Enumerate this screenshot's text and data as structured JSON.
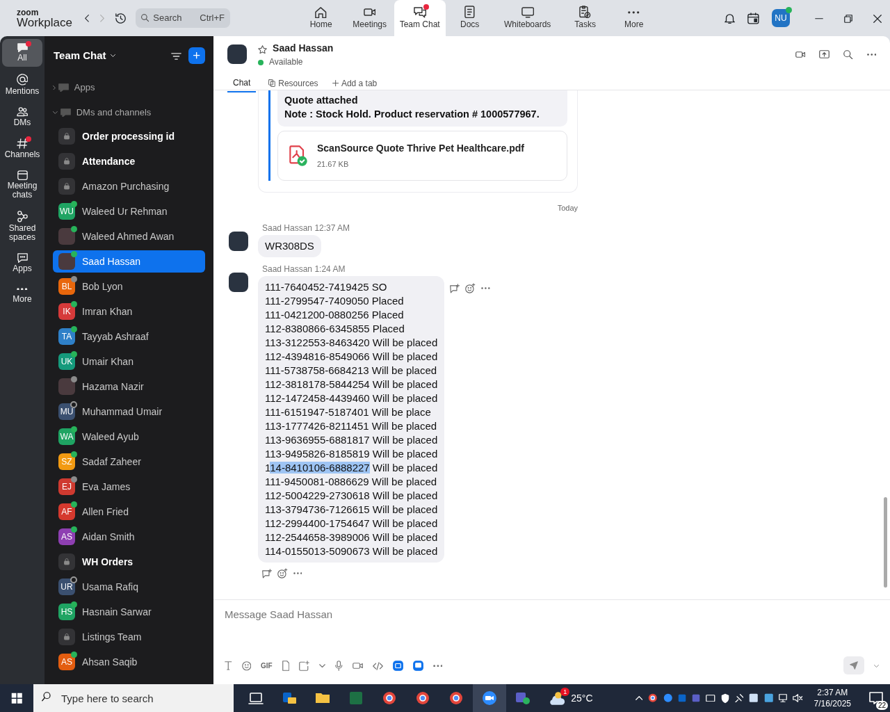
{
  "app": {
    "logo_top": "zoom",
    "logo": "Workplace",
    "search": {
      "placeholder": "Search",
      "shortcut": "Ctrl+F"
    },
    "nav_tabs": [
      {
        "label": "Home",
        "selected": false,
        "badge": false
      },
      {
        "label": "Meetings",
        "selected": false,
        "badge": false
      },
      {
        "label": "Team Chat",
        "selected": true,
        "badge": true
      },
      {
        "label": "Docs",
        "selected": false,
        "badge": false
      },
      {
        "label": "Whiteboards",
        "selected": false,
        "badge": false
      },
      {
        "label": "Tasks",
        "selected": false,
        "badge": false
      },
      {
        "label": "More",
        "selected": false,
        "badge": false
      }
    ],
    "profile": {
      "initials": "NU",
      "presence_dot": {
        "color": "#27b35a",
        "hollow": false
      }
    }
  },
  "rail": [
    {
      "label": "All",
      "selected": true,
      "badge": true
    },
    {
      "label": "Mentions",
      "selected": false,
      "badge": false
    },
    {
      "label": "DMs",
      "selected": false,
      "badge": false
    },
    {
      "label": "Channels",
      "selected": false,
      "badge": true
    },
    {
      "label": "Meeting chats",
      "selected": false,
      "badge": false
    },
    {
      "label": "Shared spaces",
      "selected": false,
      "badge": false
    },
    {
      "label": "Apps",
      "selected": false,
      "badge": false
    },
    {
      "label": "More",
      "selected": false,
      "badge": false
    }
  ],
  "sidebar": {
    "title": "Team Chat",
    "sections": [
      {
        "label": "Apps",
        "expanded": false
      },
      {
        "label": "DMs and channels",
        "expanded": true
      }
    ],
    "chats": [
      {
        "kind": "channel",
        "name": "Order processing id",
        "unread": true,
        "selected": false
      },
      {
        "kind": "channel",
        "name": "Attendance",
        "unread": true,
        "selected": false
      },
      {
        "kind": "channel",
        "name": "Amazon Purchasing",
        "unread": false,
        "selected": false
      },
      {
        "kind": "initials",
        "initials": "WU",
        "color": "#1fa463",
        "name": "Waleed Ur Rehman",
        "unread": false,
        "selected": false,
        "presence_dot": {
          "color": "#27b35a",
          "hollow": false
        }
      },
      {
        "kind": "photo",
        "name": "Waleed Ahmed Awan",
        "unread": false,
        "selected": false,
        "presence_dot": {
          "color": "#27b35a",
          "hollow": false
        }
      },
      {
        "kind": "photo",
        "name": "Saad Hassan",
        "unread": false,
        "selected": true,
        "presence_dot": {
          "color": "#27b35a",
          "hollow": false
        }
      },
      {
        "kind": "initials",
        "initials": "BL",
        "color": "#e8670c",
        "name": "Bob Lyon",
        "unread": false,
        "selected": false,
        "presence_dot": {
          "color": "#8b8b8b",
          "hollow": false
        }
      },
      {
        "kind": "initials",
        "initials": "IK",
        "color": "#d63a3a",
        "name": "Imran Khan",
        "unread": false,
        "selected": false,
        "presence_dot": {
          "color": "#27b35a",
          "hollow": false
        }
      },
      {
        "kind": "initials",
        "initials": "TA",
        "color": "#2f80c8",
        "name": "Tayyab Ashraaf",
        "unread": false,
        "selected": false,
        "presence_dot": {
          "color": "#27b35a",
          "hollow": false
        }
      },
      {
        "kind": "initials",
        "initials": "UK",
        "color": "#159a7c",
        "name": "Umair Khan",
        "unread": false,
        "selected": false,
        "presence_dot": {
          "color": "#27b35a",
          "hollow": false
        }
      },
      {
        "kind": "photo",
        "name": "Hazama Nazir",
        "unread": false,
        "selected": false,
        "presence_dot": {
          "color": "#8b8b8b",
          "hollow": false
        }
      },
      {
        "kind": "initials",
        "initials": "MU",
        "color": "#3b5070",
        "name": "Muhammad Umair",
        "unread": false,
        "selected": false,
        "presence_dot": {
          "color": "#9a9a9a",
          "hollow": true
        }
      },
      {
        "kind": "initials",
        "initials": "WA",
        "color": "#1fa463",
        "name": "Waleed Ayub",
        "unread": false,
        "selected": false,
        "presence_dot": {
          "color": "#27b35a",
          "hollow": false
        }
      },
      {
        "kind": "initials",
        "initials": "SZ",
        "color": "#f29a12",
        "name": "Sadaf Zaheer",
        "unread": false,
        "selected": false,
        "presence_dot": {
          "color": "#27b35a",
          "hollow": false
        }
      },
      {
        "kind": "initials",
        "initials": "EJ",
        "color": "#cf3a30",
        "name": "Eva James",
        "unread": false,
        "selected": false,
        "presence_dot": {
          "color": "#8b8b8b",
          "hollow": false
        }
      },
      {
        "kind": "initials",
        "initials": "AF",
        "color": "#d5392e",
        "name": "Allen Fried",
        "unread": false,
        "selected": false,
        "presence_dot": {
          "color": "#27b35a",
          "hollow": false
        }
      },
      {
        "kind": "initials",
        "initials": "AS",
        "color": "#8e3fb2",
        "name": "Aidan Smith",
        "unread": false,
        "selected": false,
        "presence_dot": {
          "color": "#27b35a",
          "hollow": false
        }
      },
      {
        "kind": "channel",
        "name": "WH Orders",
        "unread": true,
        "selected": false
      },
      {
        "kind": "initials",
        "initials": "UR",
        "color": "#3b5070",
        "name": "Usama Rafiq",
        "unread": false,
        "selected": false,
        "presence_dot": {
          "color": "#9a9a9a",
          "hollow": true
        }
      },
      {
        "kind": "initials",
        "initials": "HS",
        "color": "#1fa463",
        "name": "Hasnain Sarwar",
        "unread": false,
        "selected": false,
        "presence_dot": {
          "color": "#27b35a",
          "hollow": false
        }
      },
      {
        "kind": "channel",
        "name": "Listings Team",
        "unread": false,
        "selected": false
      },
      {
        "kind": "initials",
        "initials": "AS",
        "color": "#e35d10",
        "name": "Ahsan Saqib",
        "unread": false,
        "selected": false,
        "presence_dot": {
          "color": "#27b35a",
          "hollow": false
        }
      }
    ]
  },
  "conversation": {
    "name": "Saad Hassan",
    "status": "Available",
    "starred": false,
    "tabs": [
      {
        "label": "Chat",
        "selected": true
      },
      {
        "label": "Resources",
        "selected": false
      },
      {
        "label": "Add a tab",
        "selected": false
      }
    ],
    "quoted": {
      "lines": [
        "Quote attached",
        "Note : Stock Hold. Product reservation #  1000577967."
      ],
      "attachment": {
        "name": "ScanSource Quote Thrive Pet Healthcare.pdf",
        "size": "21.67 KB"
      }
    },
    "date_divider": "Today",
    "messages": [
      {
        "sender": "Saad Hassan",
        "time": "12:37 AM",
        "hovered": false,
        "lines": [
          "WR308DS"
        ]
      },
      {
        "sender": "Saad Hassan",
        "time": "1:24 AM",
        "hovered": true,
        "lines": [
          "111-7640452-7419425 SO",
          "111-2799547-7409050 Placed",
          "111-0421200-0880256 Placed",
          "112-8380866-6345855 Placed",
          "113-3122553-8463420 Will be placed",
          "112-4394816-8549066 Will be placed",
          "111-5738758-6684213 Will be placed",
          "112-3818178-5844254 Will be placed",
          "112-1472458-4439460 Will be placed",
          "111-6151947-5187401 Will be place",
          "113-1777426-8211451 Will be placed",
          "113-9636955-6881817 Will be placed",
          "113-9495826-8185819 Will be placed",
          {
            "parts": [
              {
                "text": "1",
                "selected": false
              },
              {
                "text": "14-8410106-6888227",
                "selected": true
              },
              {
                "text": " Will be placed",
                "selected": false
              }
            ]
          },
          "111-9450081-0886629 Will be placed",
          "112-5004229-2730618 Will be placed",
          "113-3794736-7126615 Will be placed",
          "112-2994400-1754647 Will be placed",
          "112-2544658-3989006 Will be placed",
          "114-0155013-5090673 Will be placed"
        ]
      }
    ],
    "composer": {
      "placeholder": "Message Saad Hassan",
      "gif_label": "GIF"
    }
  },
  "taskbar": {
    "search_placeholder": "Type here to search",
    "weather_badge": "1",
    "temperature": "25°C",
    "time": "2:37 AM",
    "date": "7/16/2025",
    "notifications": "22"
  }
}
